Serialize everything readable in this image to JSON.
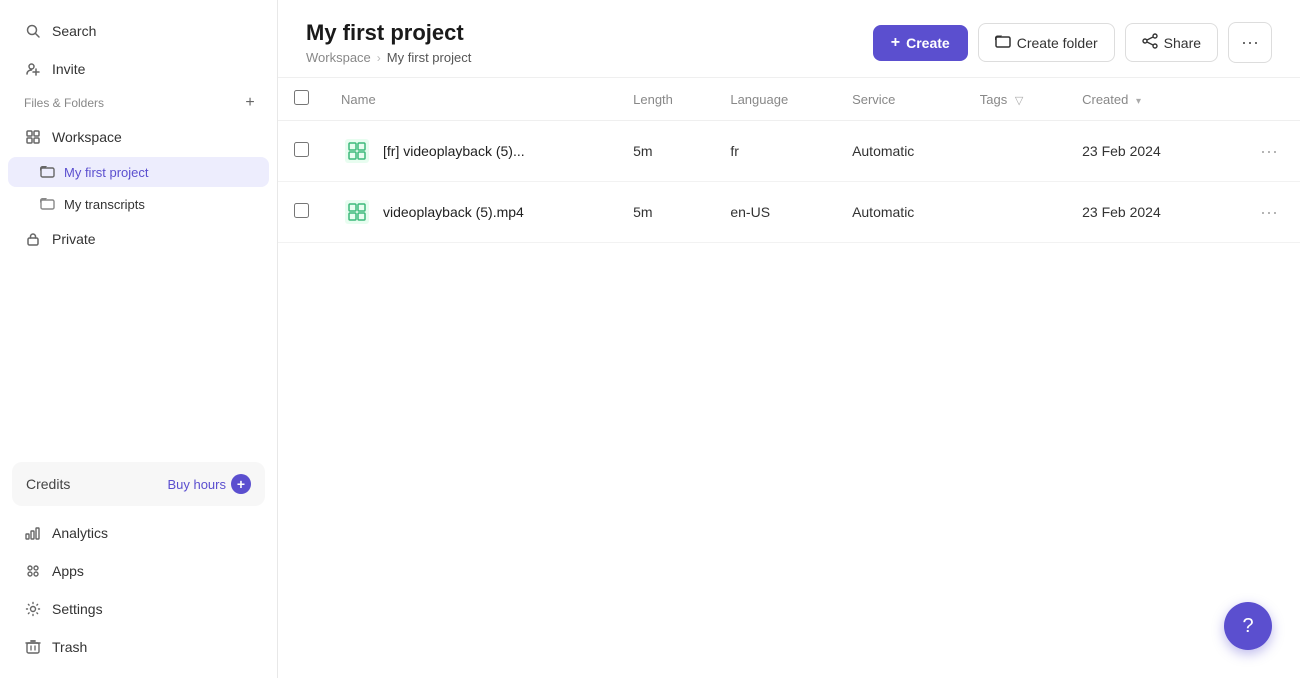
{
  "sidebar": {
    "search_label": "Search",
    "invite_label": "Invite",
    "files_folders_label": "Files & Folders",
    "workspace_label": "Workspace",
    "my_first_project_label": "My first project",
    "my_transcripts_label": "My transcripts",
    "private_label": "Private",
    "credits_label": "Credits",
    "buy_hours_label": "Buy hours",
    "analytics_label": "Analytics",
    "apps_label": "Apps",
    "settings_label": "Settings",
    "trash_label": "Trash"
  },
  "header": {
    "title": "My first project",
    "breadcrumb_workspace": "Workspace",
    "breadcrumb_project": "My first project",
    "create_label": "Create",
    "create_folder_label": "Create folder",
    "share_label": "Share"
  },
  "table": {
    "columns": {
      "name": "Name",
      "length": "Length",
      "language": "Language",
      "service": "Service",
      "tags": "Tags",
      "created": "Created"
    },
    "rows": [
      {
        "name": "[fr] videoplayback (5)...",
        "length": "5m",
        "language": "fr",
        "service": "Automatic",
        "tags": "",
        "created": "23 Feb 2024"
      },
      {
        "name": "videoplayback (5).mp4",
        "length": "5m",
        "language": "en-US",
        "service": "Automatic",
        "tags": "",
        "created": "23 Feb 2024"
      }
    ]
  }
}
